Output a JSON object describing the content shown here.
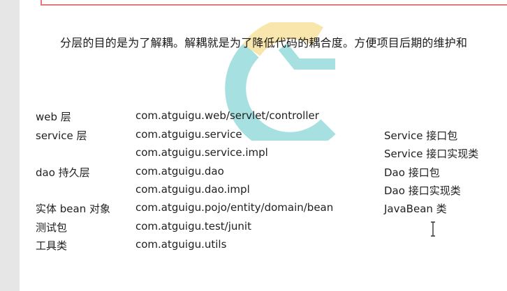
{
  "paragraph": "分层的目的是为了解耦。解耦就是为了降低代码的耦合度。方便项目后期的维护和",
  "rows": [
    {
      "layer": "web 层",
      "package": "com.atguigu.web/servlet/controller",
      "note": ""
    },
    {
      "layer": "service 层",
      "package": "com.atguigu.service",
      "note": "Service 接口包"
    },
    {
      "layer": "",
      "package": "com.atguigu.service.impl",
      "note": "Service 接口实现类"
    },
    {
      "layer": "dao 持久层",
      "package": "com.atguigu.dao",
      "note": "Dao 接口包"
    },
    {
      "layer": "",
      "package": "com.atguigu.dao.impl",
      "note": "Dao 接口实现类"
    },
    {
      "layer": "实体 bean 对象",
      "package": "com.atguigu.pojo/entity/domain/bean",
      "note": "JavaBean 类"
    },
    {
      "layer": "测试包",
      "package": "com.atguigu.test/junit",
      "note": ""
    },
    {
      "layer": "工具类",
      "package": "com.atguigu.utils",
      "note": ""
    }
  ],
  "colors": {
    "watermark_teal": "#5ec8c8",
    "watermark_yellow": "#f3d36a",
    "previous_box_border": "#e07a7a"
  },
  "icons": {
    "watermark": "logo-watermark-icon",
    "cursor": "text-cursor-icon"
  }
}
